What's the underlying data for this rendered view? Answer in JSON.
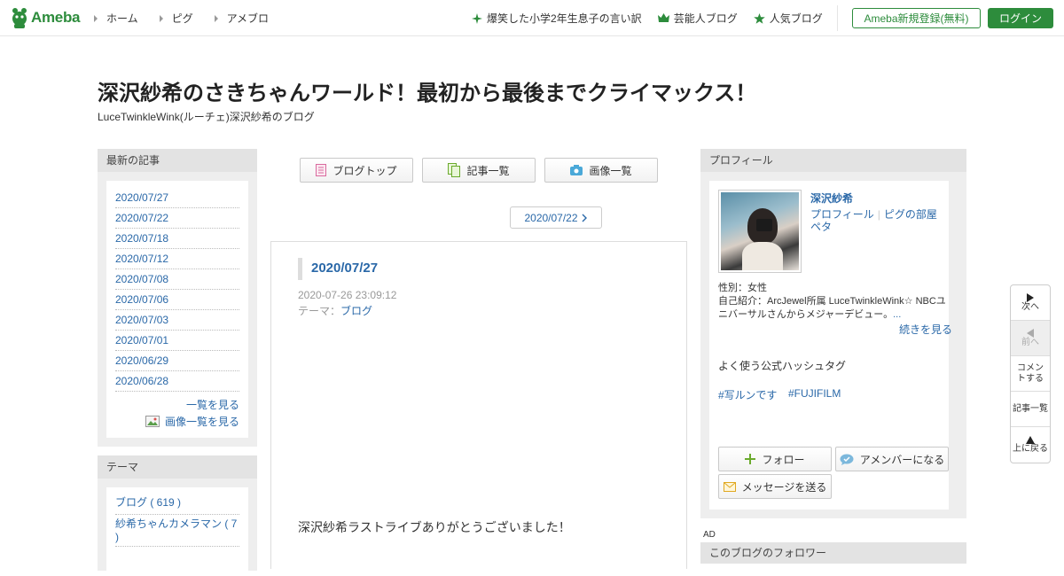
{
  "header": {
    "logo": "Ameba",
    "nav": [
      "ホーム",
      "ピグ",
      "アメブロ"
    ],
    "links": [
      "爆笑した小学2年生息子の言い訳",
      "芸能人ブログ",
      "人気ブログ"
    ],
    "register_label": "Ameba新規登録(無料)",
    "login_label": "ログイン",
    "accent": "#2d8c3c"
  },
  "blog": {
    "title": "深沢紗希のさきちゃんワールド！最初から最後までクライマックス！",
    "subtitle": "LuceTwinkleWink(ルーチェ)深沢紗希のブログ"
  },
  "recent": {
    "heading": "最新の記事",
    "items": [
      "2020/07/27",
      "2020/07/22",
      "2020/07/18",
      "2020/07/12",
      "2020/07/08",
      "2020/07/06",
      "2020/07/03",
      "2020/07/01",
      "2020/06/29",
      "2020/06/28"
    ],
    "see_all": "一覧を見る",
    "see_images": "画像一覧を見る"
  },
  "themes": {
    "heading": "テーマ",
    "items": [
      "ブログ ( 619 )",
      "紗希ちゃんカメラマン ( 7 )"
    ]
  },
  "tabs": [
    "ブログトップ",
    "記事一覧",
    "画像一覧"
  ],
  "article": {
    "prev_date": "2020/07/22",
    "title": "2020/07/27",
    "datetime": "2020-07-26 23:09:12",
    "theme_label": "テーマ：",
    "theme": "ブログ",
    "body": "深沢紗希ラストライブありがとうございました！"
  },
  "profile": {
    "heading": "プロフィール",
    "name": "深沢紗希",
    "link_profile": "プロフィール",
    "link_room": "ピグの部屋",
    "link_peta": "ペタ",
    "gender": "性別：女性",
    "intro_line1": "自己紹介：ArcJewel所属 LuceTwinkleWink☆ NBCユ",
    "intro_line2": "ニバーサルさんからメジャーデビュー。",
    "intro_more": "...",
    "read_more": "続きを見る",
    "hashtag_title": "よく使う公式ハッシュタグ",
    "hashtags": [
      "#写ルンです",
      "#FUJIFILM"
    ],
    "follow_label": "フォロー",
    "member_label": "アメンバーになる",
    "message_label": "メッセージを送る"
  },
  "ad_label": "AD",
  "followers_heading": "このブログのフォロワー",
  "float_nav": {
    "next": "次へ",
    "prev": "前へ",
    "comment": "コメントする",
    "list": "記事一覧",
    "top": "上に戻る"
  }
}
